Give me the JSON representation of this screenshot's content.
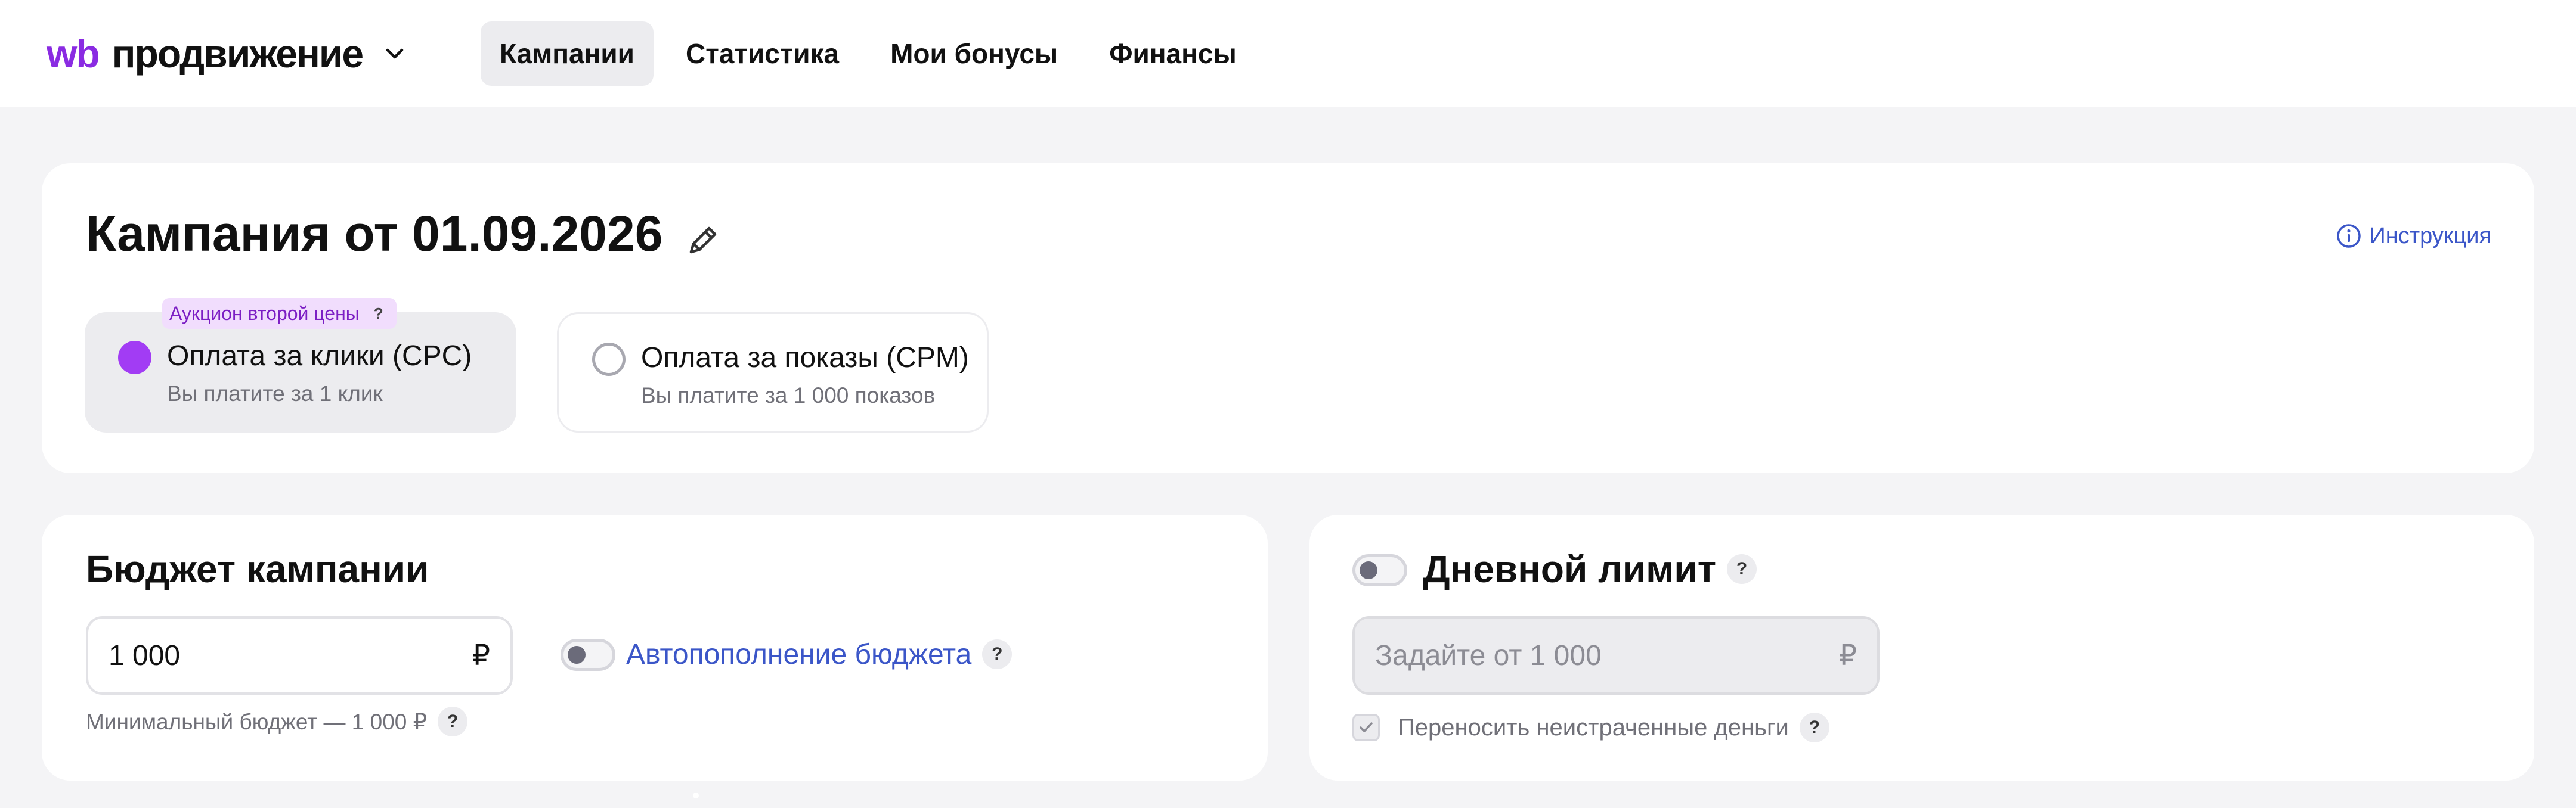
{
  "header": {
    "logo_brand": "wb",
    "logo_name": "продвижение",
    "nav": [
      {
        "label": "Кампании",
        "active": true
      },
      {
        "label": "Статистика",
        "active": false
      },
      {
        "label": "Мои бонусы",
        "active": false
      },
      {
        "label": "Финансы",
        "active": false
      }
    ]
  },
  "campaign": {
    "title": "Кампания от 01.09.2026",
    "instruction_label": "Инструкция",
    "badge": {
      "label": "Аукцион второй цены",
      "help": "?"
    },
    "payment_options": [
      {
        "title": "Оплата за клики (CPC)",
        "subtitle": "Вы платите за 1 клик",
        "selected": true
      },
      {
        "title": "Оплата за показы (CPM)",
        "subtitle": "Вы платите за 1 000 показов",
        "selected": false
      }
    ]
  },
  "budget": {
    "title": "Бюджет кампании",
    "input_value": "1 000",
    "currency": "₽",
    "hint": "Минимальный бюджет — 1 000 ₽",
    "help": "?",
    "autofill_label": "Автопополнение бюджета",
    "autofill_enabled": false
  },
  "daily_limit": {
    "title": "Дневной лимит",
    "help": "?",
    "enabled": false,
    "input_placeholder": "Задайте от 1 000",
    "currency": "₽",
    "carry_label": "Переносить неистраченные деньги",
    "carry_checked": true
  },
  "colors": {
    "accent": "#a23cf4",
    "link": "#3b56c8",
    "brand": "#8a2be2"
  }
}
